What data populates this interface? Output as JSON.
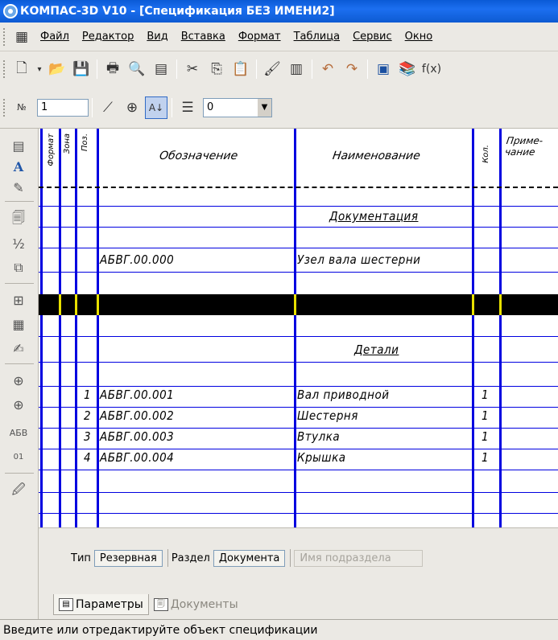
{
  "window": {
    "title": "КОМПАС-3D V10 - [Спецификация БЕЗ ИМЕНИ2]"
  },
  "menu": [
    "Файл",
    "Редактор",
    "Вид",
    "Вставка",
    "Формат",
    "Таблица",
    "Сервис",
    "Окно"
  ],
  "toolbar2": {
    "page_number": "1",
    "combo_value": "0"
  },
  "table": {
    "headers": {
      "format": "Формат",
      "zone": "Зона",
      "pos": "Поз.",
      "designation": "Обозначение",
      "name": "Наименование",
      "qty": "Кол.",
      "note": "Приме-\nчание"
    },
    "sections": {
      "documentation": "Документация",
      "parts": "Детали"
    },
    "doc_row": {
      "designation": "АБВГ.00.000",
      "name": "Узел вала шестерни"
    },
    "rows": [
      {
        "pos": "1",
        "designation": "АБВГ.00.001",
        "name": "Вал приводной",
        "qty": "1"
      },
      {
        "pos": "2",
        "designation": "АБВГ.00.002",
        "name": "Шестерня",
        "qty": "1"
      },
      {
        "pos": "3",
        "designation": "АБВГ.00.003",
        "name": "Втулка",
        "qty": "1"
      },
      {
        "pos": "4",
        "designation": "АБВГ.00.004",
        "name": "Крышка",
        "qty": "1"
      }
    ]
  },
  "properties": {
    "type_label": "Тип",
    "type_value": "Резервная",
    "section_label": "Раздел",
    "section_value": "Документа",
    "subsection_label": "Имя подраздела"
  },
  "tabs": [
    "Параметры",
    "Документы"
  ],
  "status": "Введите или отредактируйте объект спецификации"
}
